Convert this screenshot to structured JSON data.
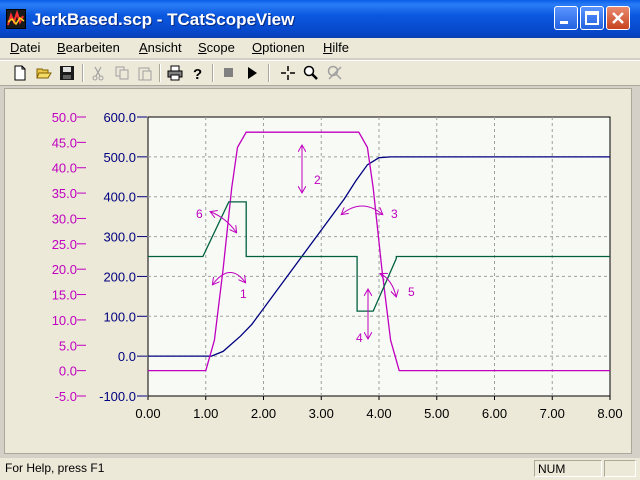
{
  "window": {
    "title": "JerkBased.scp - TCatScopeView"
  },
  "menu": [
    {
      "label_u": "D",
      "label_rest": "atei"
    },
    {
      "label_u": "B",
      "label_rest": "earbeiten"
    },
    {
      "label_u": "A",
      "label_rest": "nsicht"
    },
    {
      "label_u": "S",
      "label_rest": "cope"
    },
    {
      "label_u": "O",
      "label_rest": "ptionen"
    },
    {
      "label_u": "H",
      "label_rest": "ilfe"
    }
  ],
  "toolbar": {
    "buttons": [
      "new-icon",
      "open-icon",
      "save-icon",
      "cut-icon",
      "copy-icon",
      "paste-icon",
      "print-icon",
      "help-icon",
      "stop-icon",
      "play-icon",
      "crosshair-icon",
      "zoom-icon",
      "zoom-off-icon"
    ]
  },
  "colors": {
    "blue": "#000080",
    "magenta": "#c000c0",
    "green": "#006040",
    "plot_bg": "#f7faf5"
  },
  "chart_data": {
    "type": "line",
    "xlim": [
      0,
      8
    ],
    "x_ticks": [
      "0.00",
      "1.00",
      "2.00",
      "3.00",
      "4.00",
      "5.00",
      "6.00",
      "7.00",
      "8.00"
    ],
    "y_left_ticks": [
      "50.0",
      "45.0",
      "40.0",
      "35.0",
      "30.0",
      "25.0",
      "20.0",
      "15.0",
      "10.0",
      "5.0",
      "0.0",
      "-5.0"
    ],
    "y_right_ticks": [
      "600.0",
      "500.0",
      "400.0",
      "300.0",
      "200.0",
      "100.0",
      "0.0",
      "-100.0"
    ],
    "ylim": [
      -100,
      600
    ],
    "grid": true,
    "series": [
      {
        "axis": "right",
        "color": "blue",
        "points": [
          [
            0,
            0
          ],
          [
            1.1,
            0
          ],
          [
            1.3,
            12
          ],
          [
            1.6,
            50
          ],
          [
            1.8,
            80
          ],
          [
            3.4,
            395
          ],
          [
            3.6,
            440
          ],
          [
            3.8,
            480
          ],
          [
            4.0,
            498
          ],
          [
            4.2,
            500
          ],
          [
            8,
            500
          ]
        ]
      },
      {
        "axis": "left",
        "color": "magenta",
        "points": [
          [
            0,
            0
          ],
          [
            1.0,
            0
          ],
          [
            1.15,
            6
          ],
          [
            1.3,
            20
          ],
          [
            1.45,
            36
          ],
          [
            1.55,
            44
          ],
          [
            1.7,
            47
          ],
          [
            3.65,
            47
          ],
          [
            3.8,
            44
          ],
          [
            3.9,
            36
          ],
          [
            4.05,
            20
          ],
          [
            4.2,
            6
          ],
          [
            4.35,
            0
          ],
          [
            8,
            0
          ]
        ]
      },
      {
        "axis": "right",
        "color": "green",
        "points": [
          [
            0,
            250
          ],
          [
            0.95,
            250
          ],
          [
            1.4,
            387
          ],
          [
            1.7,
            387
          ],
          [
            1.7,
            250
          ],
          [
            3.62,
            250
          ],
          [
            3.62,
            113
          ],
          [
            3.9,
            113
          ],
          [
            4.3,
            245
          ],
          [
            4.3,
            250
          ],
          [
            8,
            250
          ]
        ]
      }
    ],
    "annotations": [
      "1",
      "2",
      "3",
      "4",
      "5",
      "6"
    ]
  },
  "status": {
    "help_text": "For Help, press F1",
    "num": "NUM"
  }
}
